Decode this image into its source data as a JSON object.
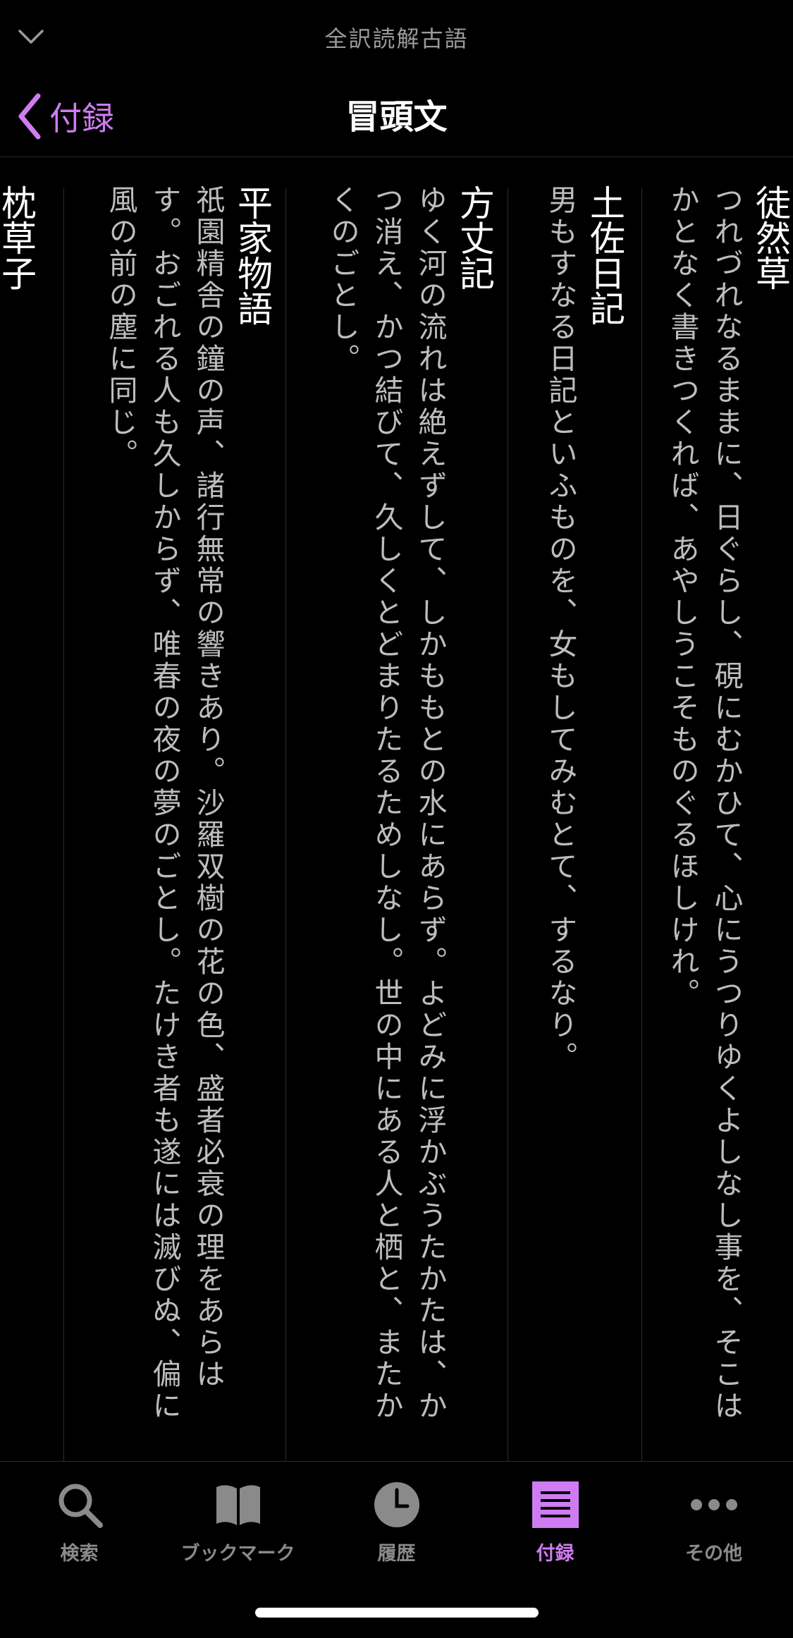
{
  "header": {
    "app_title": "全訳読解古語"
  },
  "nav": {
    "back_label": "付録",
    "title": "冒頭文"
  },
  "sections": [
    {
      "title": "徒然草",
      "body": "つれづれなるままに、日ぐらし、硯にむかひて、心にうつりゆくよしなし事を、そこはかとなく書きつくれば、あやしうこそものぐるほしけれ。"
    },
    {
      "title": "土佐日記",
      "body": "男もすなる日記といふものを、女もしてみむとて、するなり。"
    },
    {
      "title": "方丈記",
      "body": "ゆく河の流れは絶えずして、しかももとの水にあらず。よどみに浮かぶうたかたは、かつ消え、かつ結びて、久しくとどまりたるためしなし。世の中にある人と栖と、またかくのごとし。"
    },
    {
      "title": "平家物語",
      "body": "祇園精舎の鐘の声、諸行無常の響きあり。沙羅双樹の花の色、盛者必衰の理をあらはす。おごれる人も久しからず、唯春の夜の夢のごとし。たけき者も遂には滅びぬ、偏に風の前の塵に同じ。"
    },
    {
      "title": "枕草子",
      "body": ""
    }
  ],
  "tabs": [
    {
      "label": "検索",
      "icon": "search-icon",
      "active": false
    },
    {
      "label": "ブックマーク",
      "icon": "bookmark-book-icon",
      "active": false
    },
    {
      "label": "履歴",
      "icon": "history-clock-icon",
      "active": false
    },
    {
      "label": "付録",
      "icon": "appendix-list-icon",
      "active": true
    },
    {
      "label": "その他",
      "icon": "more-icon",
      "active": false
    }
  ],
  "colors": {
    "accent": "#cf7cf2",
    "background": "#000000",
    "body_text": "#bdbdbd",
    "inactive_tab": "#8a8a8a"
  }
}
